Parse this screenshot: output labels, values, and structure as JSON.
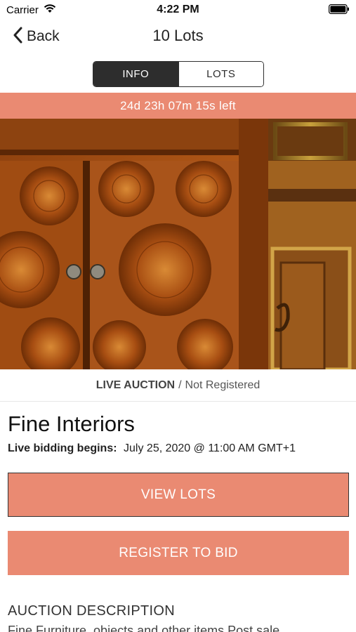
{
  "status_bar": {
    "carrier": "Carrier",
    "time": "4:22 PM",
    "wifi_icon": "wifi-icon",
    "battery_icon": "battery-icon"
  },
  "nav": {
    "back_label": "Back",
    "back_icon": "chevron-left-icon",
    "title": "10 Lots"
  },
  "tabs": [
    {
      "label": "INFO",
      "active": true
    },
    {
      "label": "LOTS",
      "active": false
    }
  ],
  "countdown": "24d 23h 07m 15s left",
  "hero_image": {
    "subject": "walnut-inlaid-cabinet-photo"
  },
  "auction_status": {
    "type": "LIVE AUCTION",
    "separator": "/",
    "registration": "Not Registered"
  },
  "auction": {
    "title": "Fine Interiors",
    "date_label": "Live bidding begins:",
    "date_value": "July 25, 2020 @ 11:00 AM GMT+1"
  },
  "buttons": {
    "view_lots": "VIEW LOTS",
    "register": "REGISTER TO BID"
  },
  "description": {
    "heading": "AUCTION DESCRIPTION",
    "text": "Fine Furniture, objects and other items Post sale"
  },
  "colors": {
    "accent": "#ea8a72",
    "segment_active": "#2d2d2d"
  }
}
